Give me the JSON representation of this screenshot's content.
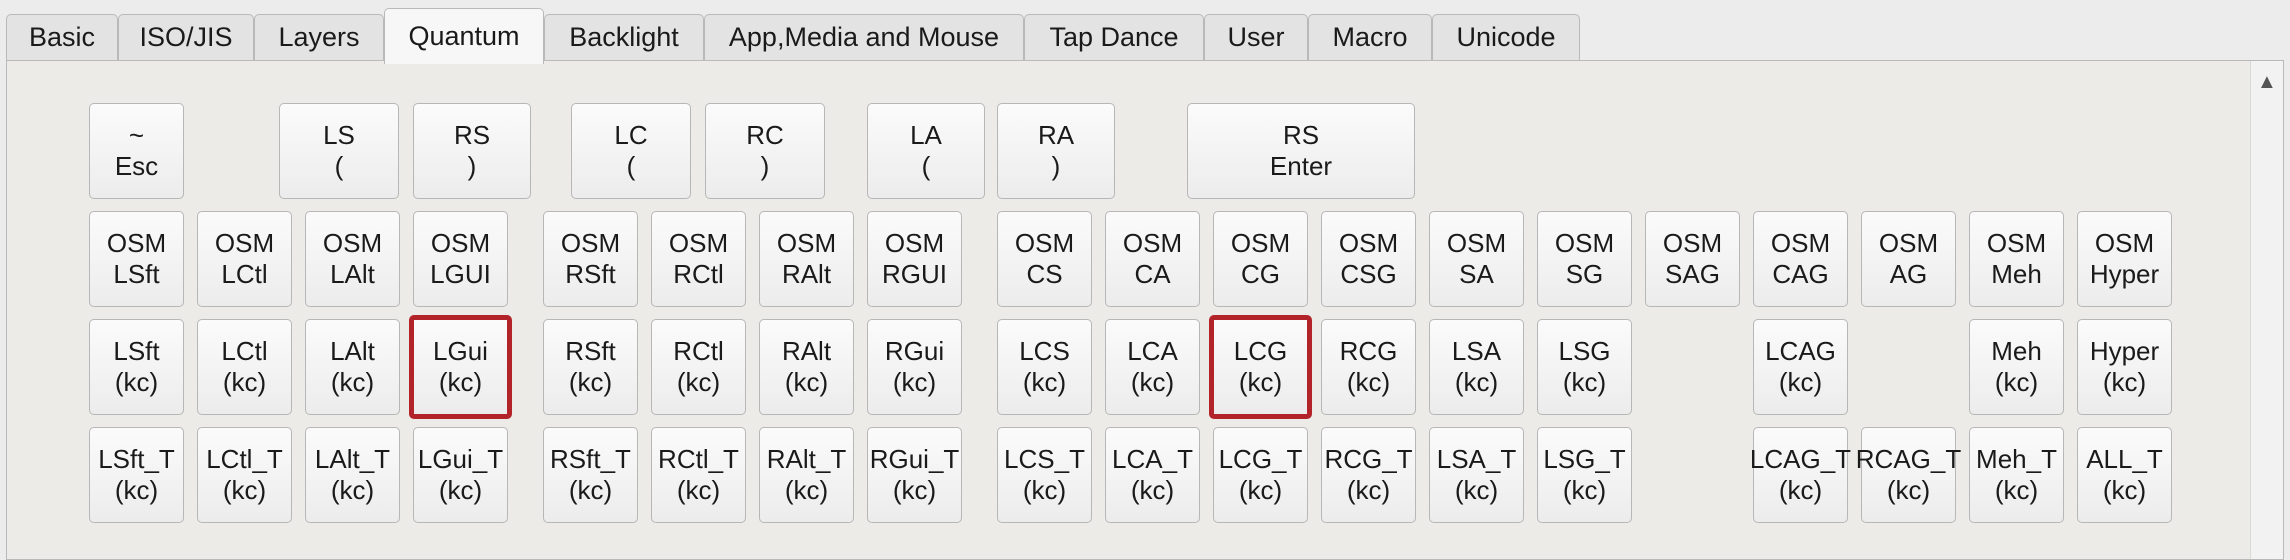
{
  "tabs": [
    {
      "label": "Basic",
      "active": false
    },
    {
      "label": "ISO/JIS",
      "active": false
    },
    {
      "label": "Layers",
      "active": false
    },
    {
      "label": "Quantum",
      "active": true
    },
    {
      "label": "Backlight",
      "active": false
    },
    {
      "label": "App,Media and Mouse",
      "active": false
    },
    {
      "label": "Tap Dance",
      "active": false
    },
    {
      "label": "User",
      "active": false
    },
    {
      "label": "Macro",
      "active": false
    },
    {
      "label": "Unicode",
      "active": false
    }
  ],
  "scrollbar": {
    "up_icon": "chevron-up-icon",
    "glyph": "▲"
  },
  "accent_color": "#b3232a",
  "rows": [
    [
      {
        "name": "grave-esc",
        "l1": "~",
        "l2": "Esc"
      },
      {
        "name": "lshift-paren",
        "l1": "LS",
        "l2": "("
      },
      {
        "name": "rshift-paren",
        "l1": "RS",
        "l2": ")"
      },
      {
        "name": "lctl-paren",
        "l1": "LC",
        "l2": "("
      },
      {
        "name": "rctl-paren",
        "l1": "RC",
        "l2": ")"
      },
      {
        "name": "lalt-paren",
        "l1": "LA",
        "l2": "("
      },
      {
        "name": "ralt-paren",
        "l1": "RA",
        "l2": ")"
      },
      {
        "name": "rshift-enter",
        "l1": "RS",
        "l2": "Enter"
      }
    ],
    [
      {
        "name": "osm-lsft",
        "l1": "OSM",
        "l2": "LSft"
      },
      {
        "name": "osm-lctl",
        "l1": "OSM",
        "l2": "LCtl"
      },
      {
        "name": "osm-lalt",
        "l1": "OSM",
        "l2": "LAlt"
      },
      {
        "name": "osm-lgui",
        "l1": "OSM",
        "l2": "LGUI"
      },
      {
        "name": "osm-rsft",
        "l1": "OSM",
        "l2": "RSft"
      },
      {
        "name": "osm-rctl",
        "l1": "OSM",
        "l2": "RCtl"
      },
      {
        "name": "osm-ralt",
        "l1": "OSM",
        "l2": "RAlt"
      },
      {
        "name": "osm-rgui",
        "l1": "OSM",
        "l2": "RGUI"
      },
      {
        "name": "osm-cs",
        "l1": "OSM",
        "l2": "CS"
      },
      {
        "name": "osm-ca",
        "l1": "OSM",
        "l2": "CA"
      },
      {
        "name": "osm-cg",
        "l1": "OSM",
        "l2": "CG"
      },
      {
        "name": "osm-csg",
        "l1": "OSM",
        "l2": "CSG"
      },
      {
        "name": "osm-sa",
        "l1": "OSM",
        "l2": "SA"
      },
      {
        "name": "osm-sg",
        "l1": "OSM",
        "l2": "SG"
      },
      {
        "name": "osm-sag",
        "l1": "OSM",
        "l2": "SAG"
      },
      {
        "name": "osm-cag",
        "l1": "OSM",
        "l2": "CAG"
      },
      {
        "name": "osm-ag",
        "l1": "OSM",
        "l2": "AG"
      },
      {
        "name": "osm-meh",
        "l1": "OSM",
        "l2": "Meh"
      },
      {
        "name": "osm-hyper",
        "l1": "OSM",
        "l2": "Hyper"
      }
    ],
    [
      {
        "name": "lsft-kc",
        "l1": "LSft",
        "l2": "(kc)"
      },
      {
        "name": "lctl-kc",
        "l1": "LCtl",
        "l2": "(kc)"
      },
      {
        "name": "lalt-kc",
        "l1": "LAlt",
        "l2": "(kc)"
      },
      {
        "name": "lgui-kc",
        "l1": "LGui",
        "l2": "(kc)",
        "selected": true
      },
      {
        "name": "rsft-kc",
        "l1": "RSft",
        "l2": "(kc)"
      },
      {
        "name": "rctl-kc",
        "l1": "RCtl",
        "l2": "(kc)"
      },
      {
        "name": "ralt-kc",
        "l1": "RAlt",
        "l2": "(kc)"
      },
      {
        "name": "rgui-kc",
        "l1": "RGui",
        "l2": "(kc)"
      },
      {
        "name": "lcs-kc",
        "l1": "LCS",
        "l2": "(kc)"
      },
      {
        "name": "lca-kc",
        "l1": "LCA",
        "l2": "(kc)"
      },
      {
        "name": "lcg-kc",
        "l1": "LCG",
        "l2": "(kc)",
        "selected": true
      },
      {
        "name": "rcg-kc",
        "l1": "RCG",
        "l2": "(kc)"
      },
      {
        "name": "lsa-kc",
        "l1": "LSA",
        "l2": "(kc)"
      },
      {
        "name": "lsg-kc",
        "l1": "LSG",
        "l2": "(kc)"
      },
      {
        "name": "lcag-kc",
        "l1": "LCAG",
        "l2": "(kc)"
      },
      {
        "name": "meh-kc",
        "l1": "Meh",
        "l2": "(kc)"
      },
      {
        "name": "hyper-kc",
        "l1": "Hyper",
        "l2": "(kc)"
      }
    ],
    [
      {
        "name": "lsft-t-kc",
        "l1": "LSft_T",
        "l2": "(kc)"
      },
      {
        "name": "lctl-t-kc",
        "l1": "LCtl_T",
        "l2": "(kc)"
      },
      {
        "name": "lalt-t-kc",
        "l1": "LAlt_T",
        "l2": "(kc)"
      },
      {
        "name": "lgui-t-kc",
        "l1": "LGui_T",
        "l2": "(kc)"
      },
      {
        "name": "rsft-t-kc",
        "l1": "RSft_T",
        "l2": "(kc)"
      },
      {
        "name": "rctl-t-kc",
        "l1": "RCtl_T",
        "l2": "(kc)"
      },
      {
        "name": "ralt-t-kc",
        "l1": "RAlt_T",
        "l2": "(kc)"
      },
      {
        "name": "rgui-t-kc",
        "l1": "RGui_T",
        "l2": "(kc)"
      },
      {
        "name": "lcs-t-kc",
        "l1": "LCS_T",
        "l2": "(kc)"
      },
      {
        "name": "lca-t-kc",
        "l1": "LCA_T",
        "l2": "(kc)"
      },
      {
        "name": "lcg-t-kc",
        "l1": "LCG_T",
        "l2": "(kc)"
      },
      {
        "name": "rcg-t-kc",
        "l1": "RCG_T",
        "l2": "(kc)"
      },
      {
        "name": "lsa-t-kc",
        "l1": "LSA_T",
        "l2": "(kc)"
      },
      {
        "name": "lsg-t-kc",
        "l1": "LSG_T",
        "l2": "(kc)"
      },
      {
        "name": "lcag-t-kc",
        "l1": "LCAG_T",
        "l2": "(kc)"
      },
      {
        "name": "rcag-t-kc",
        "l1": "RCAG_T",
        "l2": "(kc)"
      },
      {
        "name": "meh-t-kc",
        "l1": "Meh_T",
        "l2": "(kc)"
      },
      {
        "name": "all-t-kc",
        "l1": "ALL_T",
        "l2": "(kc)"
      }
    ]
  ]
}
